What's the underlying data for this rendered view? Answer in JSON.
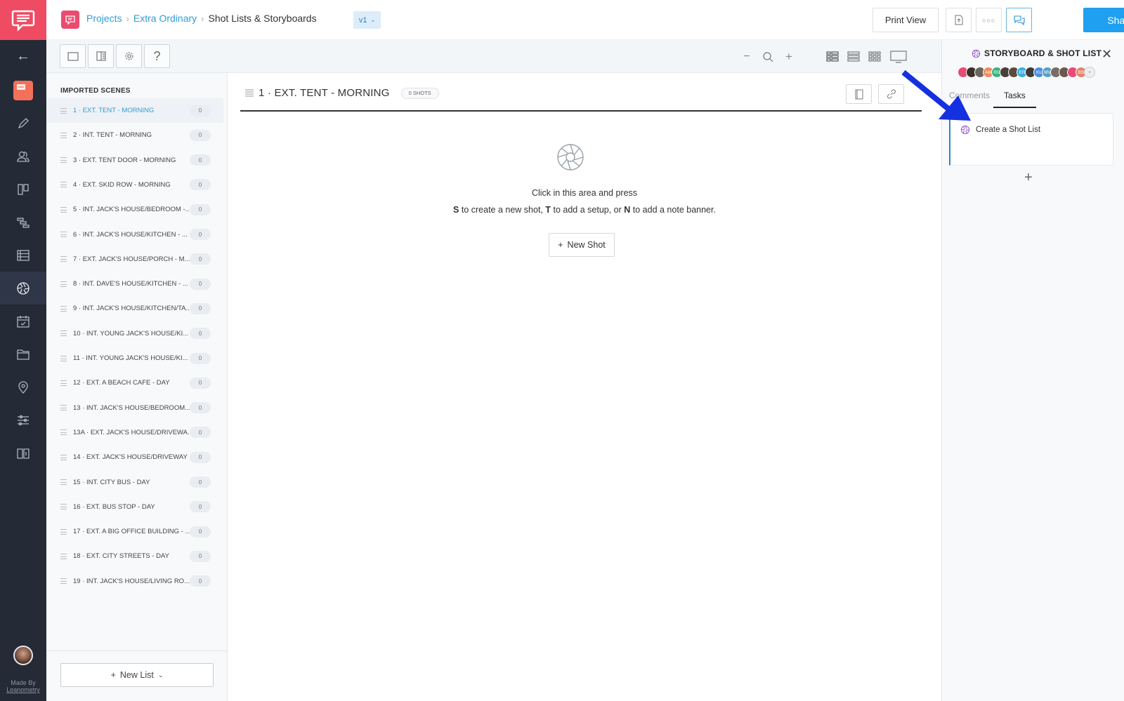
{
  "rail": {
    "back_icon": "arrow-left-icon",
    "items": [
      {
        "name": "projects",
        "icon": "project-card-icon"
      },
      {
        "name": "script",
        "icon": "pencil-icon"
      },
      {
        "name": "characters",
        "icon": "people-icon"
      },
      {
        "name": "moodboard",
        "icon": "columns-icon"
      },
      {
        "name": "schedule",
        "icon": "gantt-icon"
      },
      {
        "name": "breakdown",
        "icon": "list-icon"
      },
      {
        "name": "shot-list",
        "icon": "aperture-icon",
        "active": true
      },
      {
        "name": "calendar",
        "icon": "calendar-icon"
      },
      {
        "name": "files",
        "icon": "folder-icon"
      },
      {
        "name": "locations",
        "icon": "location-pin-icon"
      },
      {
        "name": "settings",
        "icon": "sliders-icon"
      },
      {
        "name": "guide",
        "icon": "book-icon"
      }
    ],
    "made_by": "Made By",
    "made_by_company": "Leanometry"
  },
  "topbar": {
    "breadcrumb": [
      "Projects",
      "Extra Ordinary",
      "Shot Lists & Storyboards"
    ],
    "version": "v1",
    "print_view": "Print View",
    "share": "Share"
  },
  "scenes": {
    "heading": "IMPORTED SCENES",
    "items": [
      {
        "label": "1 · EXT. TENT - MORNING",
        "count": "0",
        "active": true
      },
      {
        "label": "2 · INT. TENT - MORNING",
        "count": "0"
      },
      {
        "label": "3 · EXT. TENT DOOR - MORNING",
        "count": "0"
      },
      {
        "label": "4 · EXT. SKID ROW - MORNING",
        "count": "0"
      },
      {
        "label": "5 · INT. JACK'S HOUSE/BEDROOM -...",
        "count": "0"
      },
      {
        "label": "6 · INT. JACK'S HOUSE/KITCHEN - ...",
        "count": "0"
      },
      {
        "label": "7 · EXT. JACK'S HOUSE/PORCH - M...",
        "count": "0"
      },
      {
        "label": "8 · INT. DAVE'S HOUSE/KITCHEN - ...",
        "count": "0"
      },
      {
        "label": "9 · INT. JACK'S HOUSE/KITCHEN/TA...",
        "count": "0"
      },
      {
        "label": "10 · INT. YOUNG JACK'S HOUSE/KI...",
        "count": "0"
      },
      {
        "label": "11 · INT. YOUNG JACK'S HOUSE/KI...",
        "count": "0"
      },
      {
        "label": "12 · EXT. A BEACH CAFE - DAY",
        "count": "0"
      },
      {
        "label": "13 · INT. JACK'S HOUSE/BEDROOM...",
        "count": "0"
      },
      {
        "label": "13A · EXT. JACK'S HOUSE/DRIVEWA...",
        "count": "0"
      },
      {
        "label": "14 · EXT. JACK'S HOUSE/DRIVEWAY",
        "count": "0"
      },
      {
        "label": "15 · INT. CITY BUS - DAY",
        "count": "0"
      },
      {
        "label": "16 · EXT. BUS STOP - DAY",
        "count": "0"
      },
      {
        "label": "17 · EXT. A BIG OFFICE BUILDING - ...",
        "count": "0"
      },
      {
        "label": "18 · EXT. CITY STREETS - DAY",
        "count": "0"
      },
      {
        "label": "19 · INT. JACK'S HOUSE/LIVING RO...",
        "count": "0"
      }
    ],
    "new_list": "New List"
  },
  "main": {
    "scene_title": "1 · EXT. TENT - MORNING",
    "shots_badge": "0 SHOTS",
    "empty_line1": "Click in this area and press",
    "empty_key_s": "S",
    "empty_text_s": " to create a new shot, ",
    "empty_key_t": "T",
    "empty_text_t": " to add a setup, or ",
    "empty_key_n": "N",
    "empty_text_n": " to add a note banner.",
    "new_shot": "New Shot"
  },
  "sidepanel": {
    "title": "STORYBOARD & SHOT LIST",
    "avatars": [
      {
        "initials": "",
        "color": "#e94b77"
      },
      {
        "initials": "",
        "color": "#3b3128"
      },
      {
        "initials": "",
        "color": "#6b6560"
      },
      {
        "initials": "AM",
        "color": "#f08a5d"
      },
      {
        "initials": "RD",
        "color": "#3bb37a"
      },
      {
        "initials": "",
        "color": "#4a3f38"
      },
      {
        "initials": "",
        "color": "#5a4a42"
      },
      {
        "initials": "ER",
        "color": "#3aaee0"
      },
      {
        "initials": "",
        "color": "#3f3a36"
      },
      {
        "initials": "KL",
        "color": "#4a8fe0"
      },
      {
        "initials": "MV",
        "color": "#5aa0c8"
      },
      {
        "initials": "",
        "color": "#7a6d62"
      },
      {
        "initials": "",
        "color": "#6a5a4e"
      },
      {
        "initials": "",
        "color": "#e94b77"
      },
      {
        "initials": "BS",
        "color": "#e8836a"
      },
      {
        "initials": "+",
        "color": "#eeeeee"
      }
    ],
    "tabs": [
      "Comments",
      "Tasks"
    ],
    "active_tab": "Tasks",
    "tasks": [
      {
        "label": "Create a Shot List"
      }
    ],
    "annotation": {
      "type": "arrow",
      "color": "#1530e0"
    }
  }
}
